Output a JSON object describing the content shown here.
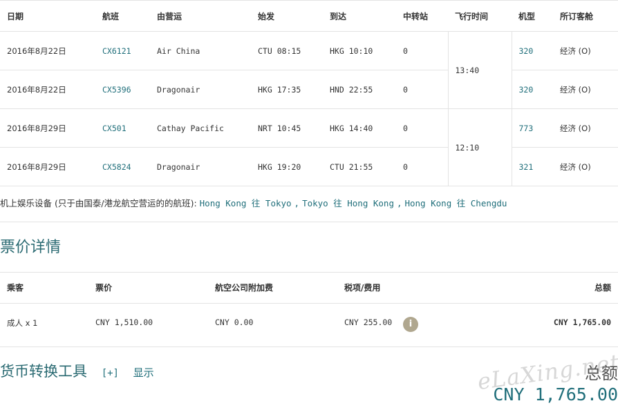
{
  "flights": {
    "headers": [
      "日期",
      "航班",
      "由营运",
      "始发",
      "到达",
      "中转站",
      "飞行时间",
      "机型",
      "所订客舱"
    ],
    "rows": [
      {
        "date": "2016年8月22日",
        "flight": "CX6121",
        "operator": "Air China",
        "from": "CTU 08:15",
        "to": "HKG 10:10",
        "stops": "0",
        "aircraft": "320",
        "cabin": "经济 (O)"
      },
      {
        "date": "2016年8月22日",
        "flight": "CX5396",
        "operator": "Dragonair",
        "from": "HKG 17:35",
        "to": "HND 22:55",
        "stops": "0",
        "aircraft": "320",
        "cabin": "经济 (O)"
      },
      {
        "date": "2016年8月29日",
        "flight": "CX501",
        "operator": "Cathay Pacific",
        "from": "NRT 10:45",
        "to": "HKG 14:40",
        "stops": "0",
        "aircraft": "773",
        "cabin": "经济 (O)"
      },
      {
        "date": "2016年8月29日",
        "flight": "CX5824",
        "operator": "Dragonair",
        "from": "HKG 19:20",
        "to": "CTU 21:55",
        "stops": "0",
        "aircraft": "321",
        "cabin": "经济 (O)"
      }
    ],
    "durations": [
      "13:40",
      "12:10"
    ]
  },
  "entertainment": {
    "label": "机上娱乐设备 (只于由国泰/港龙航空营运的的航班):",
    "links": [
      "Hong Kong 往 Tokyo",
      "Tokyo 往 Hong Kong",
      "Hong Kong 往 Chengdu"
    ],
    "separator": ","
  },
  "fare": {
    "title": "票价详情",
    "headers": {
      "passenger": "乘客",
      "fare": "票价",
      "surcharge": "航空公司附加费",
      "tax": "税项/费用",
      "total": "总额"
    },
    "row": {
      "passenger": "成人 x 1",
      "fare": "CNY 1,510.00",
      "surcharge": "CNY 0.00",
      "tax": "CNY 255.00",
      "total": "CNY 1,765.00"
    },
    "info_icon": "i"
  },
  "converter": {
    "title": "货币转换工具",
    "toggle": "[+]",
    "show": "显示"
  },
  "grand_total": {
    "label": "总额",
    "amount": "CNY 1,765.00"
  },
  "watermark": "eLaXing.net"
}
